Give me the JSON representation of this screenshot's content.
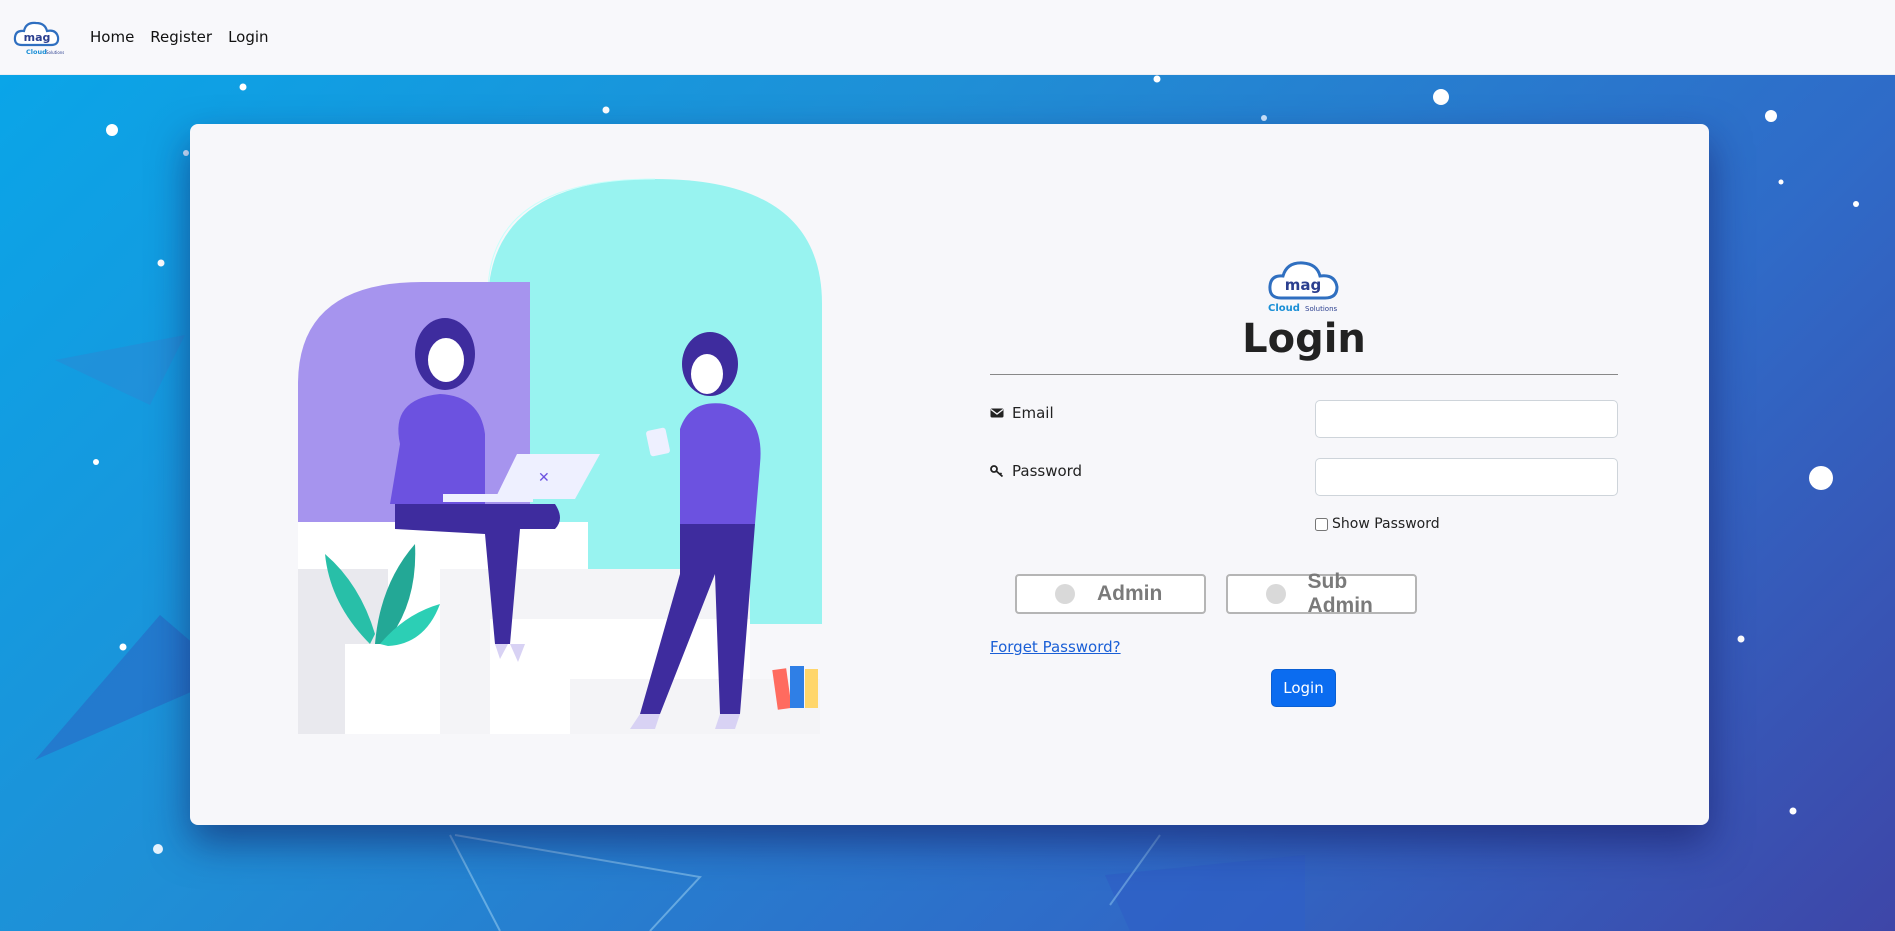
{
  "navbar": {
    "logo_text_main": "mag",
    "logo_text_sub": "Cloud",
    "logo_text_sub2": "Solutions",
    "links": [
      {
        "label": "Home"
      },
      {
        "label": "Register"
      },
      {
        "label": "Login"
      }
    ]
  },
  "form": {
    "title": "Login",
    "email_label": "Email",
    "email_value": "",
    "password_label": "Password",
    "password_value": "",
    "show_password_label": "Show Password",
    "show_password_checked": false,
    "roles": [
      {
        "label": "Admin",
        "selected": false
      },
      {
        "label": "Sub Admin",
        "selected": false
      }
    ],
    "forget_password_label": "Forget Password?",
    "submit_label": "Login"
  },
  "colors": {
    "primary": "#0b6cf0",
    "link": "#1a5fd6",
    "bg_gradient_start": "#0aa5e8",
    "bg_gradient_end": "#3e46a8",
    "card": "#f7f7fa"
  },
  "icons": {
    "email": "envelope-icon",
    "password": "key-icon",
    "checkbox": "checkbox-icon"
  }
}
